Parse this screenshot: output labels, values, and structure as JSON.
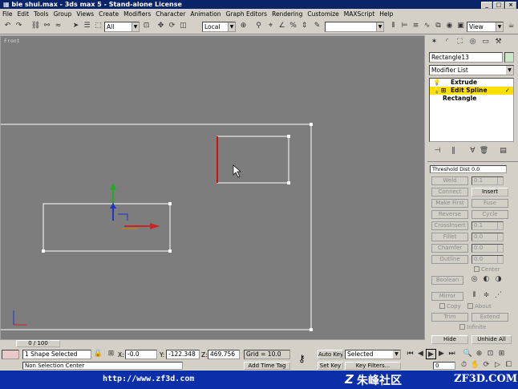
{
  "window": {
    "title": "bie shui.max - 3ds max 5 - Stand-alone License",
    "controls": [
      "_",
      "□",
      "×"
    ]
  },
  "menu": [
    "File",
    "Edit",
    "Tools",
    "Group",
    "Views",
    "Create",
    "Modifiers",
    "Character",
    "Animation",
    "Graph Editors",
    "Rendering",
    "Customize",
    "MAXScript",
    "Help"
  ],
  "toolbar": {
    "selection_filter": "All",
    "coord_system": "Local",
    "named_selection": "",
    "view_dropdown": "View"
  },
  "viewport": {
    "label": "Front",
    "bg_color": "#7d7d7d"
  },
  "command_panel": {
    "object_name": "Rectangle13",
    "modifier_list": "Modifier List",
    "stack": [
      {
        "label": "Extrude",
        "selected": false
      },
      {
        "label": "Edit Spline",
        "selected": true
      },
      {
        "label": "Rectangle",
        "selected": false
      }
    ],
    "threshold_label": "Threshold Dist",
    "threshold_value": "0.0",
    "weld_label": "Weld",
    "weld_value": "0.1",
    "connect_label": "Connect",
    "insert_label": "Insert",
    "make_first_label": "Make First",
    "fuse_label": "Fuse",
    "reverse_label": "Reverse",
    "cycle_label": "Cycle",
    "cross_insert_label": "CrossInsert",
    "cross_insert_value": "0.1",
    "fillet_label": "Fillet",
    "fillet_value": "0.0",
    "chamfer_label": "Chamfer",
    "chamfer_value": "0.0",
    "outline_label": "Outline",
    "outline_value": "0.0",
    "center_label": "Center",
    "boolean_label": "Boolean",
    "mirror_label": "Mirror",
    "copy_label": "Copy",
    "about_label": "About",
    "trim_label": "Trim",
    "extend_label": "Extend",
    "infinite_label": "Infinite",
    "hide_label": "Hide",
    "unhide_all_label": "Unhide All"
  },
  "status": {
    "frame": "0 / 100",
    "selection": "1 Shape Selected",
    "x_label": "X:",
    "x_value": "-0.0",
    "y_label": "Y:",
    "y_value": "-122.348",
    "z_label": "Z:",
    "z_value": "469.756",
    "grid": "Grid = 10.0",
    "prompt": "Non Selection Center",
    "add_time_tag": "Add Time Tag",
    "auto_key": "Auto Key",
    "selected_dropdown": "Selected",
    "set_key": "Set Key",
    "key_filters": "Key Filters...",
    "frame_field": "0"
  },
  "banner": {
    "url": "http://www.zf3d.com",
    "brand_cn": "朱峰社区",
    "brand_en": "ZF3D.COM",
    "color": "#0b2fa8"
  }
}
